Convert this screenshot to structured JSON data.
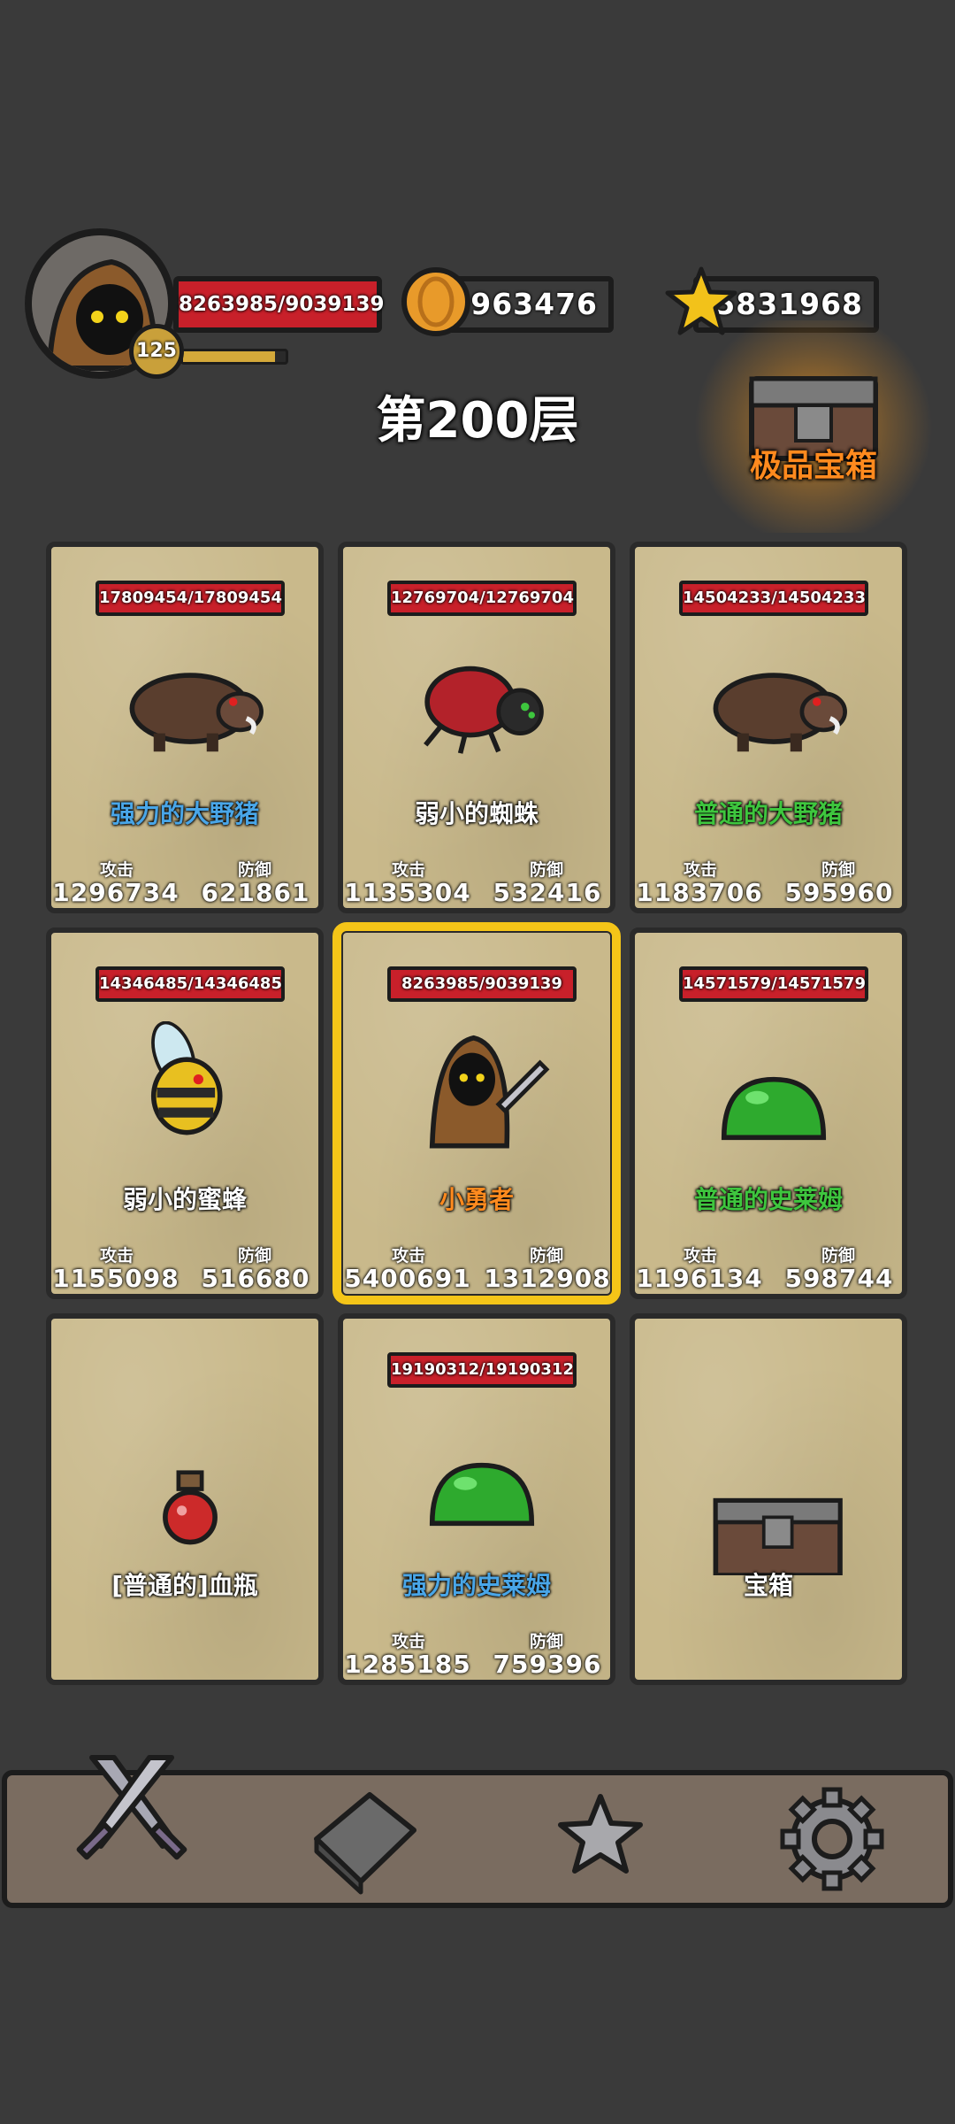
{
  "player": {
    "hp": "8263985/9039139",
    "level": "125",
    "xp_fraction": 0.9
  },
  "resources": {
    "coins": "8963476",
    "stars": "5831968"
  },
  "floor_title": "第200层",
  "chest_button_label": "极品宝箱",
  "stat_labels": {
    "attack": "攻击",
    "defense": "防御"
  },
  "cards": [
    {
      "hp": "17809454/17809454",
      "name": "强力的大野猪",
      "name_color": "blue",
      "icon": "boar-icon",
      "attack": "1296734",
      "defense": "621861"
    },
    {
      "hp": "12769704/12769704",
      "name": "弱小的蜘蛛",
      "name_color": "white",
      "icon": "spider-icon",
      "attack": "1135304",
      "defense": "532416"
    },
    {
      "hp": "14504233/14504233",
      "name": "普通的大野猪",
      "name_color": "green",
      "icon": "boar-icon",
      "attack": "1183706",
      "defense": "595960"
    },
    {
      "hp": "14346485/14346485",
      "name": "弱小的蜜蜂",
      "name_color": "white",
      "icon": "bee-icon",
      "attack": "1155098",
      "defense": "516680"
    },
    {
      "hp": "8263985/9039139",
      "name": "小勇者",
      "name_color": "orange",
      "icon": "hero-icon",
      "attack": "5400691",
      "defense": "1312908",
      "selected": true
    },
    {
      "hp": "14571579/14571579",
      "name": "普通的史莱姆",
      "name_color": "green",
      "icon": "slime-icon",
      "attack": "1196134",
      "defense": "598744"
    },
    {
      "name": "[普通的]血瓶",
      "name_color": "white",
      "icon": "potion-icon"
    },
    {
      "hp": "19190312/19190312",
      "name": "强力的史莱姆",
      "name_color": "blue",
      "icon": "slime-icon",
      "attack": "1285185",
      "defense": "759396"
    },
    {
      "name": "宝箱",
      "name_color": "white",
      "icon": "treasure-chest-icon"
    }
  ],
  "nav": [
    {
      "icon": "crossed-swords-icon",
      "active": true
    },
    {
      "icon": "book-icon"
    },
    {
      "icon": "star-icon"
    },
    {
      "icon": "gear-icon"
    }
  ],
  "colors": {
    "hp_red": "#c8202a",
    "selected_border": "#f5c518",
    "name_blue": "#49a6e8",
    "name_green": "#3ec63e",
    "name_orange": "#ff8a1e"
  }
}
